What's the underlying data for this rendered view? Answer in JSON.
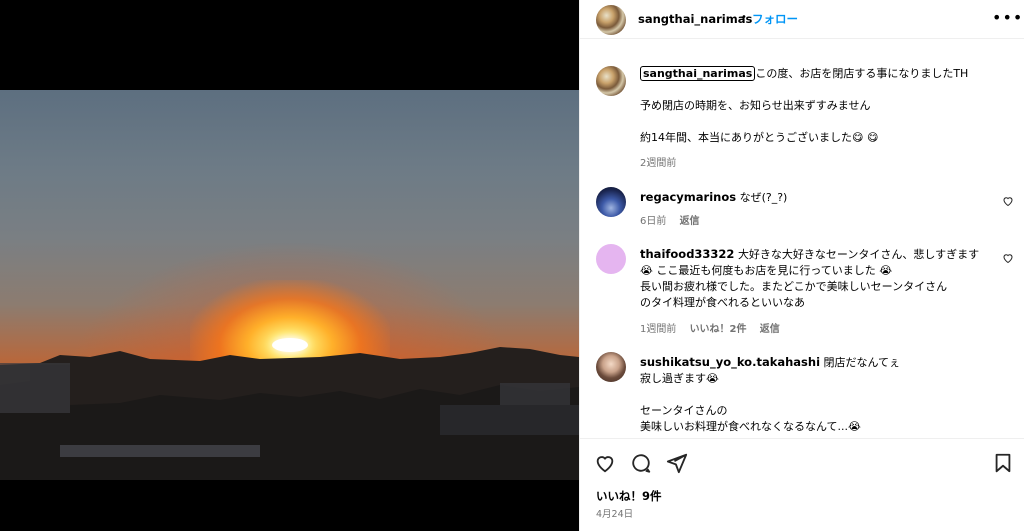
{
  "header": {
    "username": "sangthai_narimas",
    "separator": "•",
    "follow_label": "フォロー",
    "more_label": "•••"
  },
  "caption": {
    "username": "sangthai_narimas",
    "line1": "この度、お店を閉店する事になりましたTH",
    "line2": "予め閉店の時期を、お知らせ出来ずすみません",
    "line3": "約14年間、本当にありがとうございました😋 😋",
    "time": "2週間前"
  },
  "comments": [
    {
      "username": "regacymarinos",
      "text": "なぜ(?_?)",
      "time": "6日前",
      "reply_label": "返信"
    },
    {
      "username": "thaifood33322",
      "text_lines": [
        "大好きな大好きなセーンタイさん、悲しすぎます",
        "😭 ここ最近も何度もお店を見に行っていました 😭",
        "長い間お疲れ様でした。またどこかで美味しいセーンタイさん",
        "のタイ料理が食べれるといいなあ"
      ],
      "time": "1週間前",
      "likes": "いいね！2件",
      "reply_label": "返信"
    },
    {
      "username": "sushikatsu_yo_ko.takahashi",
      "text_lines": [
        "閉店だなんてぇ",
        "寂し過ぎます😭",
        "",
        "セーンタイさんの",
        "美味しいお料理が食べれなくなるなんて...😭"
      ]
    }
  ],
  "footer": {
    "likes": "いいね！9件",
    "date": "4月24日"
  },
  "icons": {
    "like": "heart-icon",
    "comment": "comment-icon",
    "share": "share-icon",
    "save": "bookmark-icon"
  }
}
